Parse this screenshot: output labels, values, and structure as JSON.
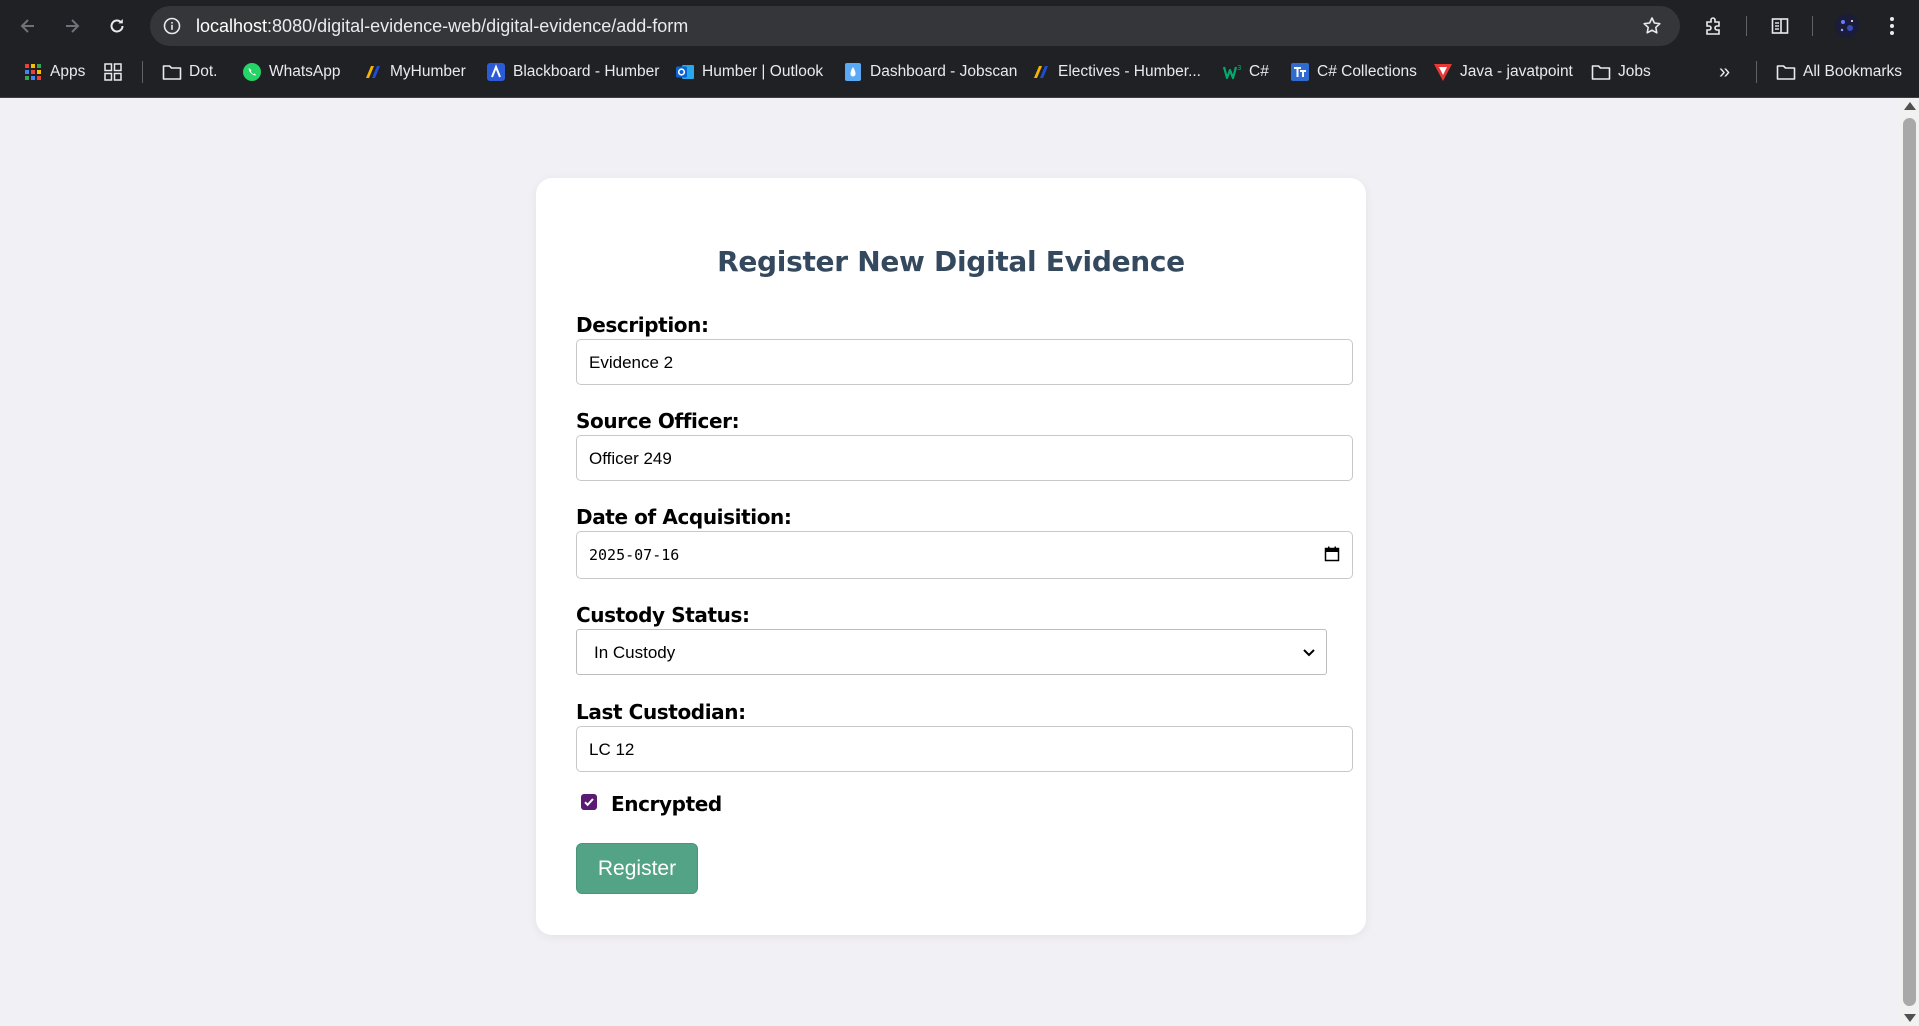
{
  "browser": {
    "url_host": "localhost",
    "url_rest": ":8080/digital-evidence-web/digital-evidence/add-form"
  },
  "bookmarks": {
    "items": [
      {
        "label": "Apps",
        "icon": "apps-grid-icon"
      },
      {
        "label": "",
        "icon": "tab-groups-icon"
      },
      {
        "label": "Dot.",
        "icon": "folder-icon"
      },
      {
        "label": "WhatsApp",
        "icon": "whatsapp-icon"
      },
      {
        "label": "MyHumber",
        "icon": "humber-icon"
      },
      {
        "label": "Blackboard - Humber",
        "icon": "blackboard-icon"
      },
      {
        "label": "Humber | Outlook",
        "icon": "outlook-icon"
      },
      {
        "label": "Dashboard - Jobscan",
        "icon": "jobscan-icon"
      },
      {
        "label": "Electives - Humber...",
        "icon": "humber-icon"
      },
      {
        "label": "C#",
        "icon": "w3-icon"
      },
      {
        "label": "C# Collections",
        "icon": "tutorialsteacher-icon"
      },
      {
        "label": "Java - javatpoint",
        "icon": "javatpoint-icon"
      },
      {
        "label": "Jobs",
        "icon": "folder-icon"
      }
    ],
    "overflow": "»",
    "all_bookmarks": "All Bookmarks"
  },
  "form": {
    "title": "Register New Digital Evidence",
    "description_label": "Description:",
    "description_value": "Evidence 2",
    "source_officer_label": "Source Officer:",
    "source_officer_value": "Officer 249",
    "date_label": "Date of Acquisition:",
    "date_value": "2025-07-16",
    "custody_status_label": "Custody Status:",
    "custody_status_value": "In Custody",
    "last_custodian_label": "Last Custodian:",
    "last_custodian_value": "LC 12",
    "encrypted_label": "Encrypted",
    "encrypted_checked": true,
    "submit_label": "Register"
  },
  "colors": {
    "title": "#34495e",
    "button": "#53a387",
    "checkbox": "#5b1a73",
    "page_bg": "#f1f0f4"
  }
}
